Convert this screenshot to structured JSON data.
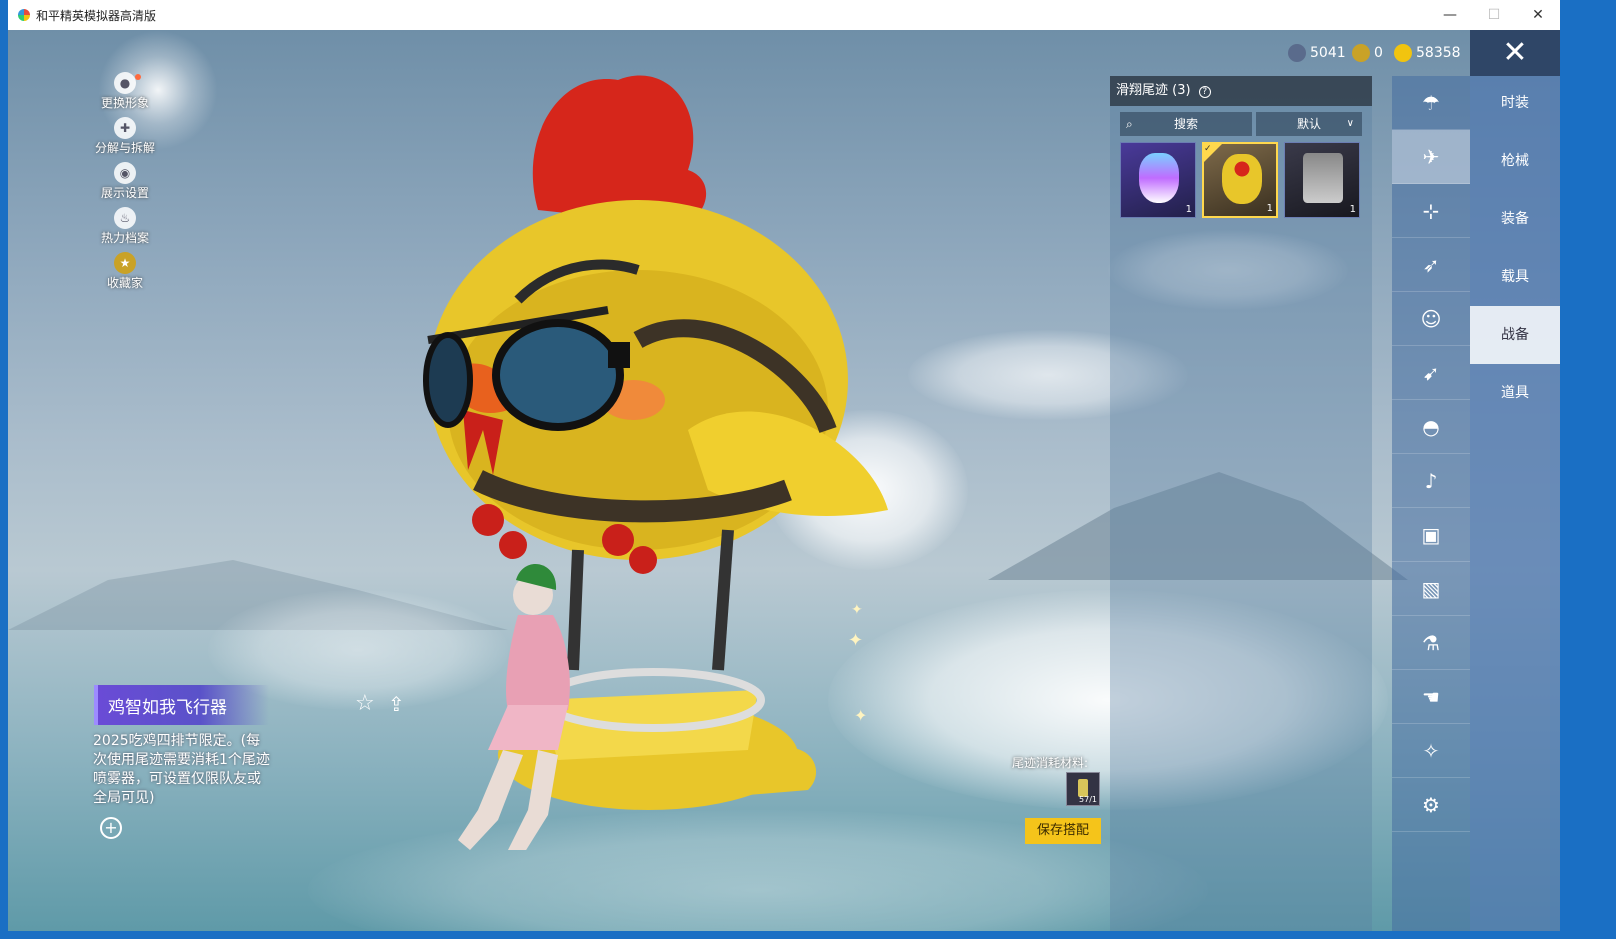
{
  "window": {
    "title": "和平精英模拟器高清版",
    "minimize": "—",
    "maximize": "☐",
    "close": "✕"
  },
  "left_menu": [
    {
      "label": "更换形象",
      "icon": "avatar-icon"
    },
    {
      "label": "分解与拆解",
      "icon": "dismantle-icon"
    },
    {
      "label": "展示设置",
      "icon": "eye-icon"
    },
    {
      "label": "热力档案",
      "icon": "fire-icon"
    },
    {
      "label": "收藏家",
      "icon": "collector-badge-icon"
    }
  ],
  "currency": [
    {
      "value": "5041",
      "icon": "globe-coin-icon",
      "color": "#5a6b8c"
    },
    {
      "value": "0",
      "icon": "gold-badge-coin-icon",
      "color": "#c9a227"
    },
    {
      "value": "58358",
      "icon": "gold-coin-icon",
      "color": "#f1c40f"
    }
  ],
  "item": {
    "name": "鸡智如我飞行器",
    "description": "2025吃鸡四排节限定。(每次使用尾迹需要消耗1个尾迹喷雾器，可设置仅限队友或全局可见)"
  },
  "panel": {
    "header": "滑翔尾迹 (3)",
    "help_icon": "?",
    "search_placeholder": "搜索",
    "sort_value": "默认",
    "thumbnails": [
      {
        "qty": "1",
        "selected": false
      },
      {
        "qty": "1",
        "selected": true
      },
      {
        "qty": "1",
        "selected": false
      }
    ]
  },
  "trail": {
    "label": "尾迹消耗材料:",
    "count": "57/1"
  },
  "save_button": "保存搭配",
  "sub_icons": [
    "parachute-icon",
    "glider-icon",
    "drone-icon",
    "plane-icon",
    "emote-face-icon",
    "jet-icon",
    "helmet-icon",
    "speaker-icon",
    "robot-icon",
    "picture-icon",
    "spray-can-icon",
    "hand-tap-icon",
    "sparkle-icon",
    "airship-icon"
  ],
  "categories": [
    "时装",
    "枪械",
    "装备",
    "载具",
    "战备",
    "道具"
  ],
  "active_category_index": 4,
  "colors": {
    "accent_yellow": "#f5c41a",
    "title_purple": "#6a4bd6",
    "panel_bg": "#5a7da0"
  }
}
